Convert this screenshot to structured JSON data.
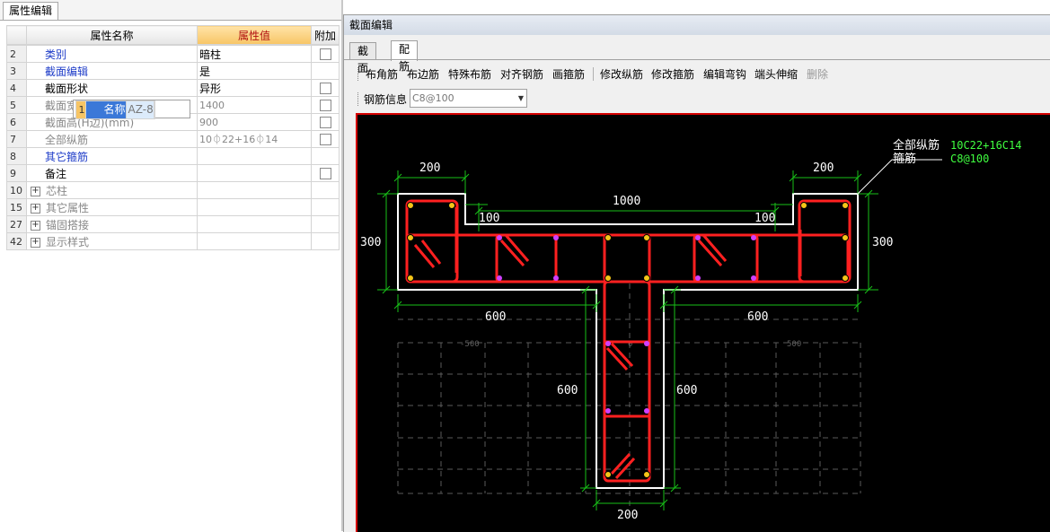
{
  "left_tab": "属性编辑",
  "table": {
    "headers": [
      "属性名称",
      "属性值",
      "附加"
    ],
    "rows": [
      {
        "num": "1",
        "name": "名称",
        "value": "AZ-8"
      },
      {
        "num": "2",
        "name": "类别",
        "value": "暗柱"
      },
      {
        "num": "3",
        "name": "截面编辑",
        "value": "是"
      },
      {
        "num": "4",
        "name": "截面形状",
        "value": "异形"
      },
      {
        "num": "5",
        "name": "截面宽(B边)(mm)",
        "value": "1400"
      },
      {
        "num": "6",
        "name": "截面高(H边)(mm)",
        "value": "900"
      },
      {
        "num": "7",
        "name": "全部纵筋",
        "value": "10⏀22+16⏀14"
      },
      {
        "num": "8",
        "name": "其它箍筋",
        "value": ""
      },
      {
        "num": "9",
        "name": "备注",
        "value": ""
      },
      {
        "num": "10",
        "name": "芯柱",
        "value": ""
      },
      {
        "num": "15",
        "name": "其它属性",
        "value": ""
      },
      {
        "num": "27",
        "name": "锚固搭接",
        "value": ""
      },
      {
        "num": "42",
        "name": "显示样式",
        "value": ""
      }
    ]
  },
  "editor": {
    "title": "截面编辑",
    "tabs": [
      "截面",
      "配筋"
    ],
    "toolbar": [
      "布角筋",
      "布边筋",
      "特殊布筋",
      "对齐钢筋",
      "画箍筋",
      "修改纵筋",
      "修改箍筋",
      "编辑弯钩",
      "端头伸缩",
      "删除"
    ],
    "info_label": "钢筋信息",
    "info_value": "C8@100"
  },
  "drawing": {
    "dims": {
      "top_left_flange": "200",
      "top_right_flange": "200",
      "top_span": "1000",
      "notch_left": "100",
      "notch_right": "100",
      "height_left": "300",
      "height_right": "300",
      "left_arm": "600",
      "right_arm": "600",
      "stem_left": "600",
      "stem_right": "600",
      "stem_width": "200",
      "grid_left": "-500",
      "grid_center": "0",
      "grid_right": "500"
    },
    "legend": {
      "label1": "全部纵筋",
      "value1": "10C22+16C14",
      "label2": "箍筋",
      "value2": "C8@100"
    },
    "colors": {
      "rebar": "#ff2020",
      "outline": "#ffffff",
      "dimension": "#18c018",
      "legend_value": "#40ff40",
      "grid": "#5a5a5a"
    }
  }
}
